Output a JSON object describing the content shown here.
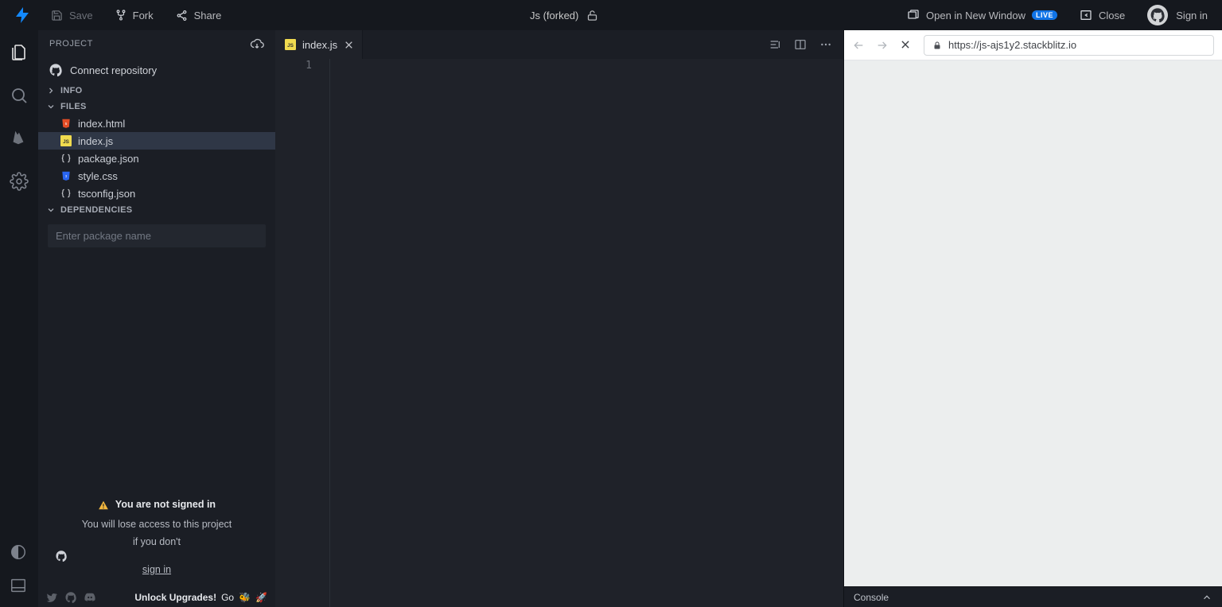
{
  "menubar": {
    "save": "Save",
    "fork": "Fork",
    "share": "Share",
    "title": "Js (forked)",
    "open_new_window": "Open in New Window",
    "live_badge": "LIVE",
    "close": "Close",
    "sign_in": "Sign in"
  },
  "sidebar": {
    "header": "PROJECT",
    "connect_repo": "Connect repository",
    "section_info": "INFO",
    "section_files": "FILES",
    "files": [
      {
        "name": "index.html"
      },
      {
        "name": "index.js"
      },
      {
        "name": "package.json"
      },
      {
        "name": "style.css"
      },
      {
        "name": "tsconfig.json"
      }
    ],
    "section_dependencies": "DEPENDENCIES",
    "dep_placeholder": "Enter package name",
    "not_signed_in_title": "You are not signed in",
    "not_signed_in_line": "You will lose access to this project",
    "not_signed_in_prefix": "if you don't",
    "sign_in_link": "sign in",
    "unlock_label": "Unlock Upgrades!",
    "go_label": "Go"
  },
  "editor": {
    "tab_label": "index.js",
    "line_number": "1"
  },
  "preview": {
    "url": "https://js-ajs1y2.stackblitz.io",
    "console_label": "Console"
  }
}
